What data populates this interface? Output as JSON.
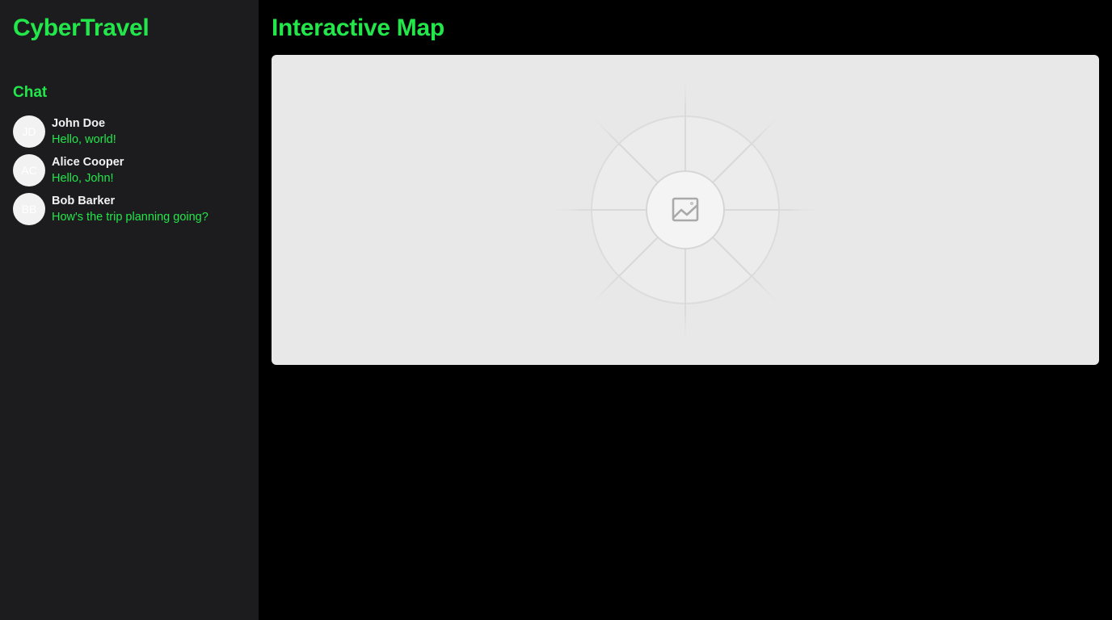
{
  "sidebar": {
    "brand": "CyberTravel",
    "chat_heading": "Chat",
    "chats": [
      {
        "initials": "JD",
        "name": "John Doe",
        "message": "Hello, world!"
      },
      {
        "initials": "AC",
        "name": "Alice Cooper",
        "message": "Hello, John!"
      },
      {
        "initials": "BB",
        "name": "Bob Barker",
        "message": "How's the trip planning going?"
      }
    ]
  },
  "main": {
    "title": "Interactive Map",
    "map": {
      "icon": "image-placeholder-icon"
    }
  },
  "colors": {
    "accent": "#22e64a",
    "sidebar_bg": "#1c1c1e",
    "page_bg": "#000000",
    "map_bg": "#e8e8e8"
  }
}
